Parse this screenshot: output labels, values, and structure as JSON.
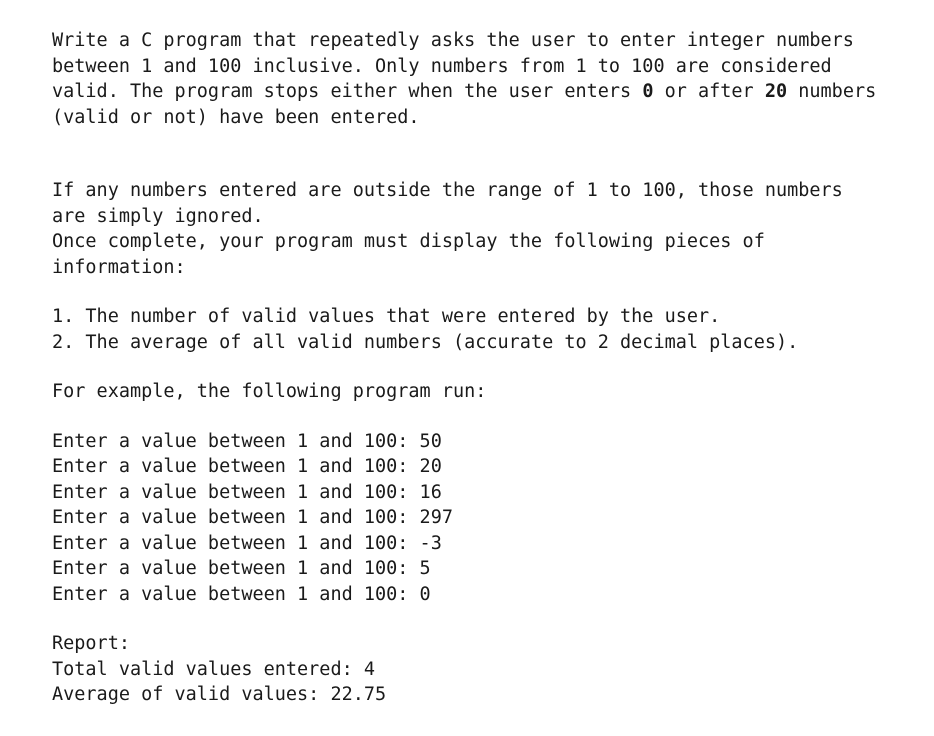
{
  "intro": {
    "part1": "Write a C program that repeatedly asks the user to enter integer numbers between 1 and 100 inclusive. Only numbers from 1 to 100 are considered valid. The program stops either when the user enters ",
    "bold1": "0",
    "part2": " or after ",
    "bold2": "20",
    "part3": " numbers (valid or not) have been entered."
  },
  "ignore_para": "If any numbers entered are outside the range of 1 to 100, those numbers are simply ignored.",
  "once_complete": "Once complete, your program must display the following pieces of information:",
  "list": {
    "item1": "1. The number of valid values that were entered by the user.",
    "item2": "2. The average of all valid numbers (accurate to 2 decimal places)."
  },
  "example_intro": "For example, the following program run:",
  "run": {
    "l1": "Enter a value between 1 and 100: 50",
    "l2": "Enter a value between 1 and 100: 20",
    "l3": "Enter a value between 1 and 100: 16",
    "l4": "Enter a value between 1 and 100: 297",
    "l5": "Enter a value between 1 and 100: -3",
    "l6": "Enter a value between 1 and 100: 5",
    "l7": "Enter a value between 1 and 100: 0"
  },
  "report": {
    "header": "Report:",
    "total": "Total valid values entered: 4",
    "average": "Average of valid values: 22.75"
  }
}
